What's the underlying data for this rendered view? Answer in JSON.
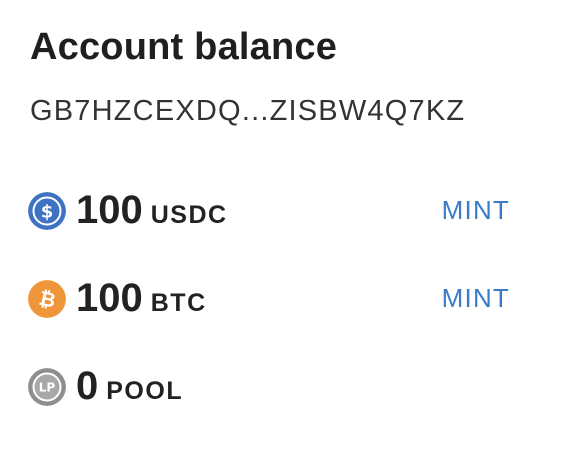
{
  "title": "Account balance",
  "address": "GB7HZCEXDQ...ZISBW4Q7KZ",
  "balances": [
    {
      "amount": "100",
      "symbol": "USDC",
      "icon": "usdc-icon",
      "color": "#3e73c4",
      "action": "MINT"
    },
    {
      "amount": "100",
      "symbol": "BTC",
      "icon": "bitcoin-icon",
      "color": "#f0963a",
      "action": "MINT"
    },
    {
      "amount": "0",
      "symbol": "POOL",
      "icon": "lp-token-icon",
      "color": "#8e8e8e",
      "icon_text": "LP"
    }
  ],
  "colors": {
    "link": "#3b7cc9",
    "text": "#222222"
  }
}
